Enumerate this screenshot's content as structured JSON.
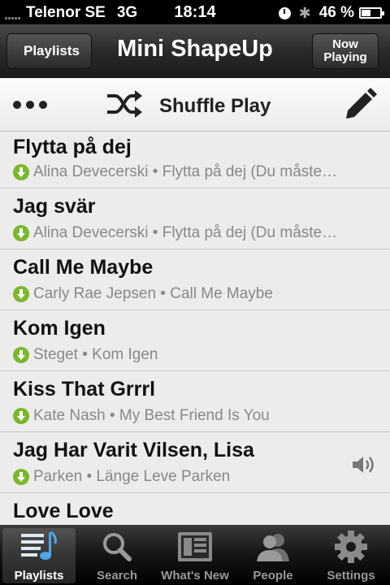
{
  "status": {
    "carrier": "Telenor SE",
    "network": "3G",
    "time": "18:14",
    "battery": "46 %"
  },
  "nav": {
    "back_label": "Playlists",
    "title": "Mini ShapeUp",
    "now_playing": [
      "Now",
      "Playing"
    ]
  },
  "toolbar": {
    "shuffle_label": "Shuffle Play"
  },
  "songs": [
    {
      "title": "Flytta på dej",
      "subtitle": "Alina Devecerski • Flytta på dej (Du måste…"
    },
    {
      "title": "Jag svär",
      "subtitle": "Alina Devecerski • Flytta på dej (Du måste…"
    },
    {
      "title": "Call Me Maybe",
      "subtitle": "Carly Rae Jepsen • Call Me Maybe"
    },
    {
      "title": "Kom Igen",
      "subtitle": "Steget • Kom Igen"
    },
    {
      "title": "Kiss That Grrrl",
      "subtitle": "Kate Nash • My Best Friend Is You"
    },
    {
      "title": "Jag Har Varit Vilsen, Lisa",
      "subtitle": "Parken • Länge Leve Parken",
      "playing": true
    },
    {
      "title": "Love Love",
      "subtitle": ""
    }
  ],
  "tabs": [
    {
      "label": "Playlists",
      "icon": "playlists-icon",
      "active": true
    },
    {
      "label": "Search",
      "icon": "search-icon"
    },
    {
      "label": "What's New",
      "icon": "whats-new-icon"
    },
    {
      "label": "People",
      "icon": "people-icon"
    },
    {
      "label": "Settings",
      "icon": "gear-icon"
    }
  ],
  "colors": {
    "download_green": "#7ab82b",
    "list_background": "#ececec",
    "subtitle_gray": "#888888"
  }
}
